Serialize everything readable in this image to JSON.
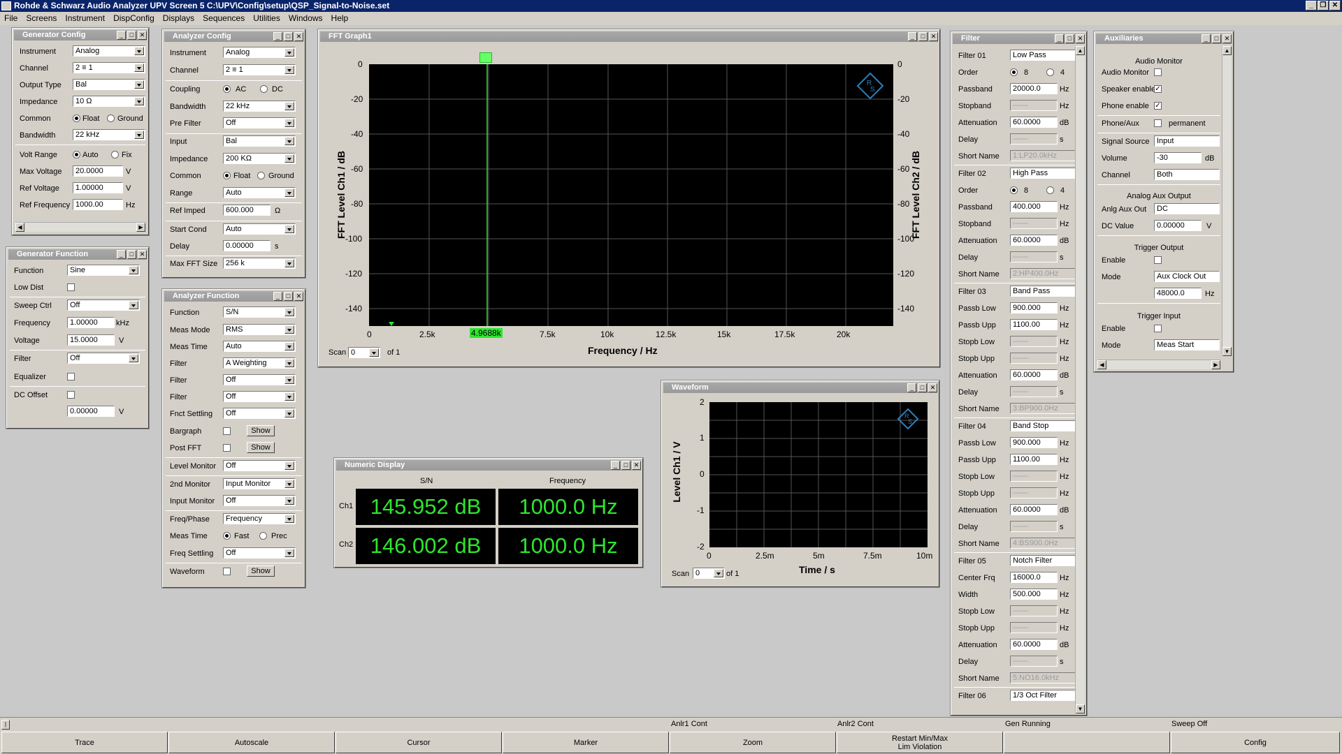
{
  "app": {
    "title": "Rohde & Schwarz Audio Analyzer UPV Screen 5  C:\\UPV\\Config\\setup\\QSP_Signal-to-Noise.set"
  },
  "menu": [
    "File",
    "Screens",
    "Instrument",
    "DispConfig",
    "Displays",
    "Sequences",
    "Utilities",
    "Windows",
    "Help"
  ],
  "gen_config": {
    "title": "Generator Config",
    "instrument_l": "Instrument",
    "instrument": "Analog",
    "channel_l": "Channel",
    "channel": "2 ≡ 1",
    "output_type_l": "Output Type",
    "output_type": "Bal",
    "impedance_l": "Impedance",
    "impedance": "10 Ω",
    "common_l": "Common",
    "float": "Float",
    "ground": "Ground",
    "bandwidth_l": "Bandwidth",
    "bandwidth": "22 kHz",
    "volt_range_l": "Volt Range",
    "auto": "Auto",
    "fix": "Fix",
    "max_voltage_l": "Max Voltage",
    "max_voltage": "20.0000",
    "ref_voltage_l": "Ref Voltage",
    "ref_voltage": "1.00000",
    "ref_frequency_l": "Ref Frequency",
    "ref_frequency": "1000.00",
    "u_v": "V",
    "u_hz": "Hz"
  },
  "gen_function": {
    "title": "Generator Function",
    "function_l": "Function",
    "function": "Sine",
    "low_dist_l": "Low Dist",
    "sweep_ctrl_l": "Sweep Ctrl",
    "sweep_ctrl": "Off",
    "frequency_l": "Frequency",
    "frequency": "1.00000",
    "frequency_u": "kHz",
    "voltage_l": "Voltage",
    "voltage": "15.0000",
    "voltage_u": "V",
    "filter_l": "Filter",
    "filter": "Off",
    "equalizer_l": "Equalizer",
    "dc_offset_l": "DC Offset",
    "dc_offset": "0.00000",
    "dc_offset_u": "V"
  },
  "an_config": {
    "title": "Analyzer Config",
    "instrument_l": "Instrument",
    "instrument": "Analog",
    "channel_l": "Channel",
    "channel": "2 ≡ 1",
    "coupling_l": "Coupling",
    "ac": "AC",
    "dc": "DC",
    "bandwidth_l": "Bandwidth",
    "bandwidth": "22 kHz",
    "pre_filter_l": "Pre Filter",
    "pre_filter": "Off",
    "input_l": "Input",
    "input": "Bal",
    "impedance_l": "Impedance",
    "impedance": "200 KΩ",
    "common_l": "Common",
    "float": "Float",
    "ground": "Ground",
    "range_l": "Range",
    "range": "Auto",
    "ref_imped_l": "Ref Imped",
    "ref_imped": "600.000",
    "ref_imped_u": "Ω",
    "start_cond_l": "Start Cond",
    "start_cond": "Auto",
    "delay_l": "Delay",
    "delay": "0.00000",
    "delay_u": "s",
    "max_fft_l": "Max FFT Size",
    "max_fft": "256 k"
  },
  "an_function": {
    "title": "Analyzer Function",
    "function_l": "Function",
    "function": "S/N",
    "meas_mode_l": "Meas Mode",
    "meas_mode": "RMS",
    "meas_time_l": "Meas Time",
    "meas_time": "Auto",
    "filter_l": "Filter",
    "filter1": "A Weighting",
    "filter2": "Off",
    "filter3": "Off",
    "fnct_settling_l": "Fnct Settling",
    "fnct_settling": "Off",
    "bargraph_l": "Bargraph",
    "post_fft_l": "Post FFT",
    "show": "Show",
    "level_monitor_l": "Level Monitor",
    "level_monitor": "Off",
    "monitor2_l": "2nd Monitor",
    "monitor2": "Input Monitor",
    "input_monitor_l": "Input Monitor",
    "input_monitor": "Off",
    "freq_phase_l": "Freq/Phase",
    "freq_phase": "Frequency",
    "meas_time2_l": "Meas Time",
    "fast": "Fast",
    "prec": "Prec",
    "freq_settling_l": "Freq Settling",
    "freq_settling": "Off",
    "waveform_l": "Waveform"
  },
  "fft": {
    "title": "FFT Graph1",
    "ylabel_left": "FFT Level Ch1 / dB",
    "ylabel_right": "FFT Level Ch2 / dB",
    "xlabel": "Frequency / Hz",
    "yticks": [
      "0",
      "-20",
      "-40",
      "-60",
      "-80",
      "-100",
      "-120",
      "-140"
    ],
    "xticks": [
      "0",
      "2.5k",
      "5k",
      "7.5k",
      "10k",
      "12.5k",
      "15k",
      "17.5k",
      "20k"
    ],
    "cursor_label": "4.9688k",
    "scan_l": "Scan",
    "scan": "0",
    "of": "of 1"
  },
  "waveform": {
    "title": "Waveform",
    "ylabel": "Level Ch1 / V",
    "xlabel": "Time / s",
    "yticks": [
      "2",
      "1",
      "0",
      "-1",
      "-2"
    ],
    "xticks": [
      "0",
      "2.5m",
      "5m",
      "7.5m",
      "10m"
    ],
    "scan_l": "Scan",
    "scan": "0",
    "of": "of 1"
  },
  "numeric": {
    "title": "Numeric Display",
    "col1": "S/N",
    "col2": "Frequency",
    "ch1": "Ch1",
    "ch2": "Ch2",
    "ch1_sn": "145.952 dB",
    "ch1_freq": "1000.0 Hz",
    "ch2_sn": "146.002 dB",
    "ch2_freq": "1000.0 Hz"
  },
  "filter": {
    "title": "Filter",
    "f01_l": "Filter 01",
    "f01": "Low Pass",
    "order_l": "Order",
    "o8": "8",
    "o4": "4",
    "passband_l": "Passband",
    "f01_passband": "20000.0",
    "stopband_l": "Stopband",
    "dashes": "------",
    "atten_l": "Attenuation",
    "atten": "60.0000",
    "delay_l": "Delay",
    "short_l": "Short Name",
    "f01_short": "1:LP20.0kHz",
    "f02_l": "Filter 02",
    "f02": "High Pass",
    "f02_passband": "400.000",
    "f02_short": "2:HP400.0Hz",
    "f03_l": "Filter 03",
    "f03": "Band Pass",
    "passb_low_l": "Passb Low",
    "passb_upp_l": "Passb Upp",
    "f03_low": "900.000",
    "f03_upp": "1100.00",
    "stopb_low_l": "Stopb Low",
    "stopb_upp_l": "Stopb Upp",
    "f03_short": "3:BP900.0Hz",
    "f04_l": "Filter 04",
    "f04": "Band Stop",
    "f04_low": "900.000",
    "f04_upp": "1100.00",
    "f04_short": "4:BS900.0Hz",
    "f05_l": "Filter 05",
    "f05": "Notch Filter",
    "center_l": "Center Frq",
    "f05_center": "16000.0",
    "width_l": "Width",
    "f05_width": "500.000",
    "f05_short": "5:NO16.0kHz",
    "f06_l": "Filter 06",
    "f06": "1/3 Oct Filter",
    "u_hz": "Hz",
    "u_db": "dB",
    "u_s": "s"
  },
  "aux": {
    "title": "Auxiliaries",
    "audio_monitor_h": "Audio Monitor",
    "audio_monitor_l": "Audio Monitor",
    "speaker_l": "Speaker enable",
    "phone_l": "Phone enable",
    "phone_aux_l": "Phone/Aux",
    "permanent": "permanent",
    "signal_source_l": "Signal Source",
    "signal_source": "Input",
    "volume_l": "Volume",
    "volume": "-30",
    "volume_u": "dB",
    "channel_l": "Channel",
    "channel": "Both",
    "analog_aux_h": "Analog Aux Output",
    "anlg_aux_l": "Anlg Aux Out",
    "anlg_aux": "DC",
    "dc_value_l": "DC Value",
    "dc_value": "0.00000",
    "dc_value_u": "V",
    "trig_out_h": "Trigger Output",
    "enable_l": "Enable",
    "mode_l": "Mode",
    "trig_out_mode": "Aux Clock Out",
    "trig_out_val": "48000.0",
    "trig_out_u": "Hz",
    "trig_in_h": "Trigger Input",
    "trig_in_mode": "Meas Start"
  },
  "status": {
    "anlr1": "Anlr1 Cont",
    "anlr2": "Anlr2 Cont",
    "gen": "Gen Running",
    "sweep": "Sweep Off"
  },
  "softkeys": [
    "Trace",
    "Autoscale",
    "Cursor",
    "Marker",
    "Zoom",
    "Restart Min/Max\nLim Violation",
    "",
    "Config"
  ],
  "colors": {
    "title_bar": "#0a246a",
    "trace": "#2ee62e",
    "plot_bg": "#000000",
    "window_bg": "#d4d0c8"
  }
}
